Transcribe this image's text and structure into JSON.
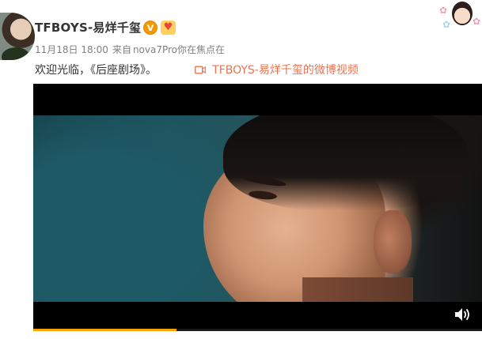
{
  "post": {
    "username": "TFBOYS-易烊千玺",
    "verified_badge": "V",
    "member_badge_icon": "heart-icon",
    "date": "11月18日 18:00",
    "source_prefix": "来自",
    "source_device": "nova7Pro你在焦点在",
    "text": "欢迎光临，《后座剧场》。",
    "video_link_icon": "video-camera-icon",
    "video_link_label": "TFBOYS-易烊千玺的微博视频"
  },
  "player": {
    "progress": 0.32,
    "volume_icon": "speaker-icon"
  },
  "colors": {
    "link": "#eb7350",
    "progress": "#f7a400",
    "verified": "#f39800",
    "meta_text": "#808080"
  }
}
